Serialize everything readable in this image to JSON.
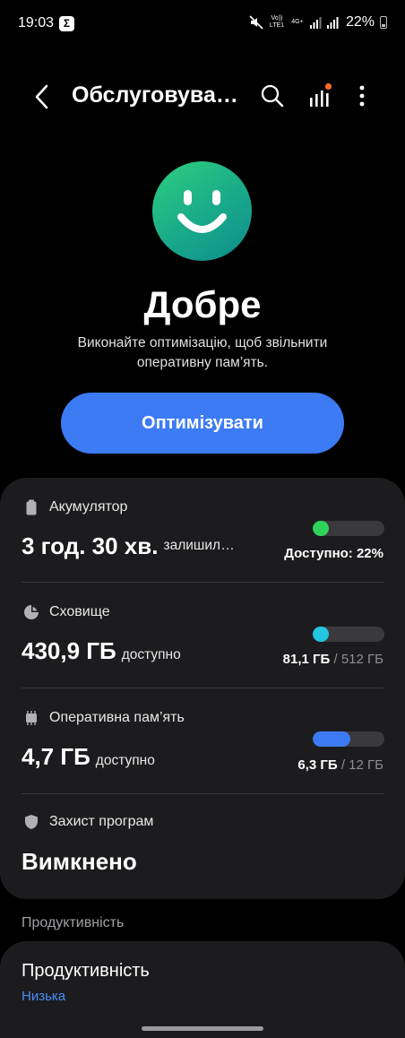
{
  "status_bar": {
    "time": "19:03",
    "app_icon_label": "Σ",
    "volte_label": "Vo)) LTE1",
    "network_label": "4G+",
    "battery_text": "22%",
    "icons": [
      "mute-icon",
      "signal-icon",
      "battery-icon"
    ]
  },
  "app_bar": {
    "title": "Обслуговування пристрою",
    "icons": [
      "back-arrow-icon",
      "search-icon",
      "bar-chart-icon",
      "more-vert-icon"
    ],
    "notification_dot_color": "#ff6a2a"
  },
  "hero": {
    "status_title": "Добре",
    "description": "Виконайте оптимізацію, щоб звільнити оперативну пам’ять.",
    "optimize_button": "Оптимізувати",
    "smiley_colors": [
      "#2ecf7e",
      "#0f8d8c"
    ]
  },
  "battery": {
    "label": "Акумулятор",
    "value": "3 год. 30 хв.",
    "value_suffix": "залишилося",
    "right_text": "Доступно: 22%",
    "level_fraction": 0.22,
    "bar_color": "#2ed35a"
  },
  "storage": {
    "label": "Сховище",
    "value": "430,9 ГБ",
    "value_suffix": "доступно",
    "used": "81,1 ГБ",
    "total": "/ 512 ГБ",
    "used_fraction": 0.16,
    "bar_color": "#22c6e0"
  },
  "ram": {
    "label": "Оперативна пам’ять",
    "value": "4,7 ГБ",
    "value_suffix": "доступно",
    "used": "6,3 ГБ",
    "total": "/ 12 ГБ",
    "used_fraction": 0.525,
    "bar_color": "#3d7bf5"
  },
  "app_protection": {
    "label": "Захист програм",
    "value": "Вимкнено"
  },
  "performance": {
    "section_header": "Продуктивність",
    "item_title": "Продуктивність",
    "item_value": "Низька"
  }
}
